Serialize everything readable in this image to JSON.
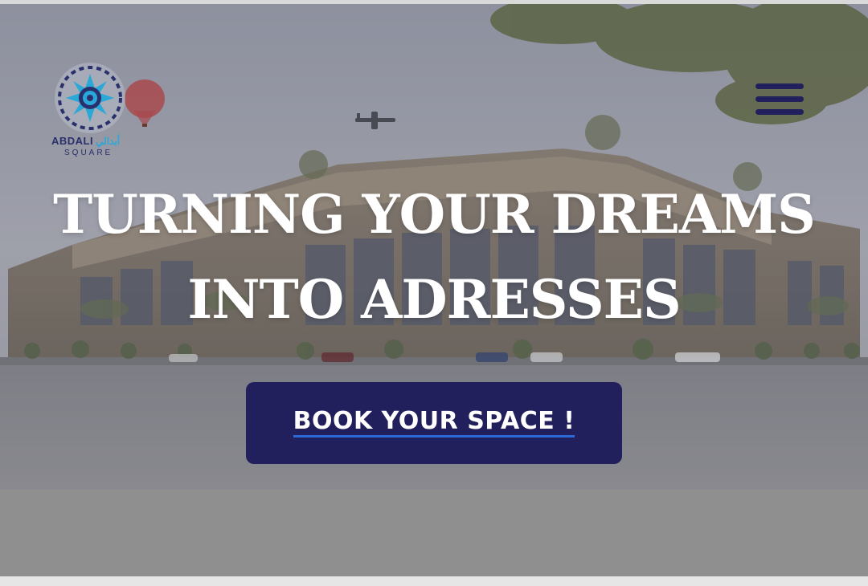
{
  "brand": {
    "name_latin": "ABDALI",
    "name_arabic": "أبدالي",
    "name_sub": "SQUARE"
  },
  "hero": {
    "headline_line1": "TURNING YOUR DREAMS",
    "headline_line2": "INTO ADRESSES",
    "cta_label": "BOOK YOUR SPACE !"
  },
  "header": {
    "menu_icon": "hamburger-menu-icon"
  },
  "colors": {
    "brand_navy": "#221f5d",
    "cta_underline": "#2a6ad8",
    "gray_band": "#8f8f8f"
  }
}
